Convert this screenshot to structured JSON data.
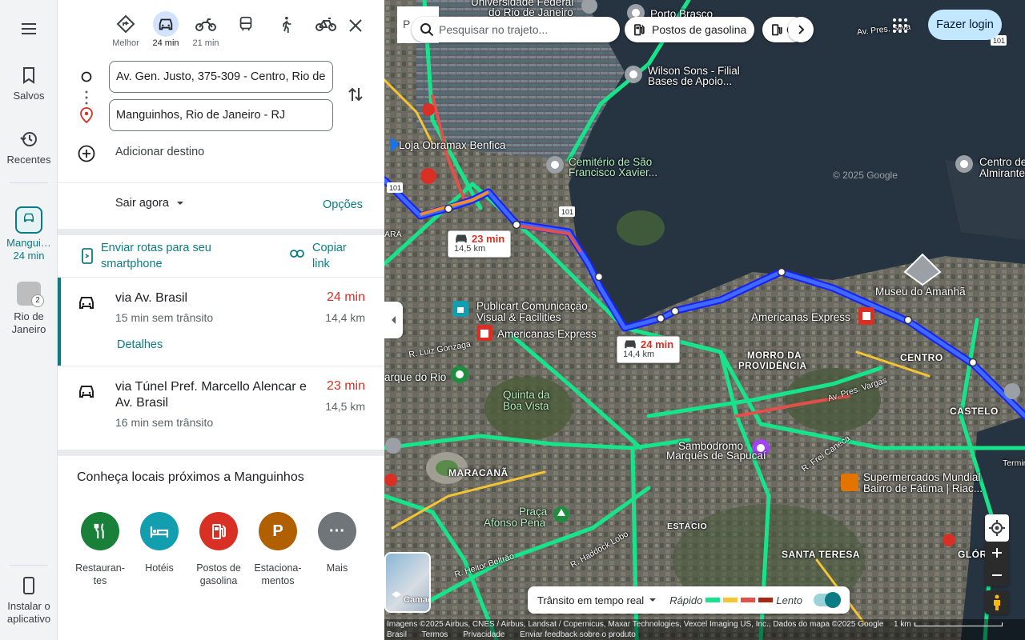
{
  "rail": {
    "saved_label": "Salvos",
    "recent_label": "Recentes",
    "trip_label_line1": "Mangui…",
    "trip_label_line2": "24 min",
    "place_label_line1": "Rio de",
    "place_label_line2": "Janeiro",
    "place_badge": "2",
    "install_label_line1": "Instalar o",
    "install_label_line2": "aplicativo"
  },
  "modes": [
    {
      "name": "best",
      "label": "Melhor"
    },
    {
      "name": "car",
      "label": "24 min"
    },
    {
      "name": "motorcycle",
      "label": "21 min"
    },
    {
      "name": "transit",
      "label": ""
    },
    {
      "name": "walk",
      "label": ""
    },
    {
      "name": "bike",
      "label": ""
    }
  ],
  "directions": {
    "origin": "Av. Gen. Justo, 375-309 - Centro, Rio de",
    "destination": "Manguinhos, Rio de Janeiro - RJ",
    "add_destination": "Adicionar destino",
    "depart": "Sair agora",
    "options": "Opções",
    "send_to_phone": "Enviar rotas para seu smartphone",
    "copy_link": "Copiar link"
  },
  "routes": [
    {
      "name": "via Av. Brasil",
      "time": "24 min",
      "no_traffic": "15 min sem trânsito",
      "distance": "14,4 km",
      "details": "Detalhes"
    },
    {
      "name": "via Túnel Pref. Marcello Alencar e Av. Brasil",
      "time": "23 min",
      "no_traffic": "16 min sem trânsito",
      "distance": "14,5 km"
    }
  ],
  "nearby": {
    "title": "Conheça locais próximos a Manguinhos",
    "categories": [
      {
        "label": "Restauran-tes",
        "color": "#188038",
        "icon": "fork-knife-icon"
      },
      {
        "label": "Hotéis",
        "color": "#129eaf",
        "icon": "bed-icon"
      },
      {
        "label": "Postos de gasolina",
        "color": "#d93025",
        "icon": "gas-pump-icon"
      },
      {
        "label": "Estaciona-mentos",
        "color": "#b06000",
        "icon": "parking-icon",
        "glyph": "P"
      },
      {
        "label": "Mais",
        "color": "#70757a",
        "icon": "more-icon",
        "glyph": "···"
      }
    ]
  },
  "map": {
    "search_placeholder": "Pesquisar no trajeto...",
    "chip_gas": "Postos de gasolina",
    "chip_partial": "C",
    "login": "Fazer login",
    "p_box": "P",
    "bubble1": {
      "time": "23 min",
      "distance": "14,5 km"
    },
    "bubble2": {
      "time": "24 min",
      "distance": "14,4 km"
    },
    "labels": {
      "univ1": "Universidade Federal",
      "univ2": "do Rio de Janeiro",
      "porto": "Porto Brasco",
      "wilson1": "Wilson Sons - Filial",
      "wilson2": "Bases de Apoio...",
      "obramax": "Loja Obramax Benfica",
      "cemit1": "Cemitério de São",
      "cemit2": "Francisco Xavier...",
      "watermark": "© 2025 Google",
      "centro_alm1": "Centro de",
      "centro_alm2": "Almirante",
      "museu": "Museu do Amanhã",
      "publicart1": "Publicart Comunicação",
      "publicart2": "Visual & Facilities",
      "americanas1": "Americanas Express",
      "americanas2": "Americanas Express",
      "morro1": "MORRO DA",
      "morro2": "PROVIDÊNCIA",
      "centro": "CENTRO",
      "luiz": "R. Luiz Gonzaga",
      "parque": "arque do Rio",
      "quinta1": "Quinta da",
      "quinta2": "Boa Vista",
      "castelo": "CASTELO",
      "sambo1": "Sambódromo",
      "sambo2": "Marquês de Sapucaí",
      "maracana": "MARACANÃ",
      "super1": "Supermercados Mundial",
      "super2": "Bairro de Fátima | Riac...",
      "praca1": "Praça",
      "praca2": "Afonso Pena",
      "estacio": "ESTÁCIO",
      "santa": "SANTA TERESA",
      "gloria": "GLÓRIA",
      "terminal": "Termina",
      "ara": "ARÁ",
      "pres_vargas": "Av. Pres. Vargas",
      "frei_caneca": "R. Frei Caneca",
      "haddock": "R. Haddock Lobo",
      "beltrao": "R. Heitor Beltrão",
      "pres_silva": "Av. Pres. Silva",
      "hwy101a": "101",
      "hwy101b": "101",
      "hwy101c": "101"
    },
    "layers_label": "Camadas",
    "traffic": {
      "mode": "Trânsito em tempo real",
      "fast": "Rápido",
      "slow": "Lento",
      "colors": [
        "#16e38a",
        "#f5c432",
        "#e2504a",
        "#a52714"
      ]
    },
    "footer": {
      "attribution": "Imagens ©2025 Airbus, CNES / Airbus, Landsat / Copernicus, Maxar Technologies, Vexcel Imaging US, Inc., Dados do mapa ©2025 Google",
      "links": [
        "Brasil",
        "Termos",
        "Privacidade",
        "Enviar feedback sobre o produto"
      ],
      "scale": "1 km"
    }
  }
}
